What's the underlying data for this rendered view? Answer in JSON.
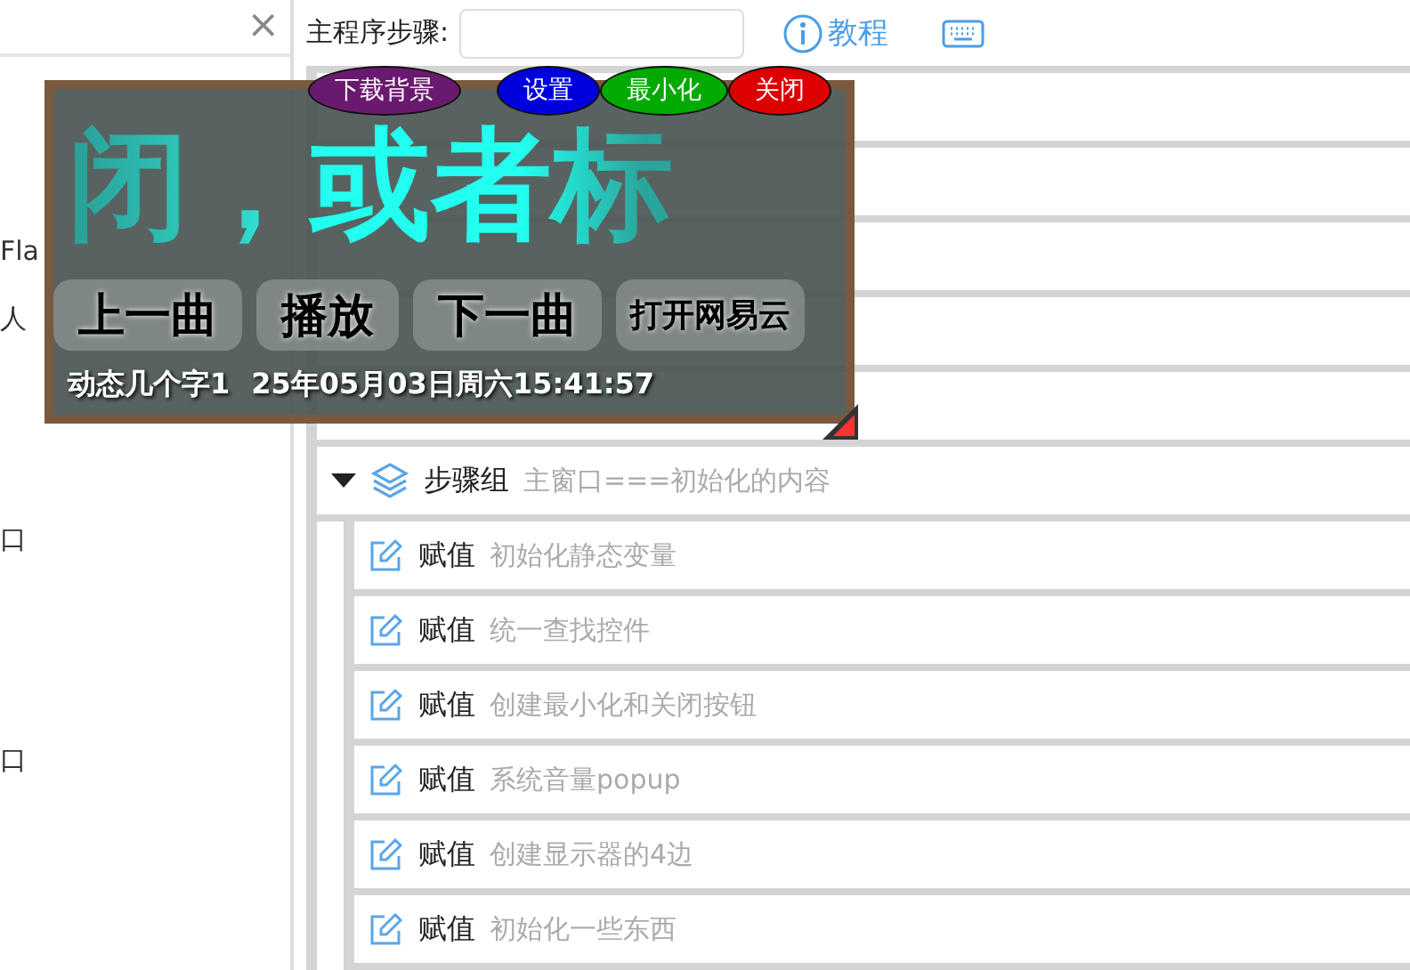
{
  "left_panel": {
    "close": "×",
    "fragments": [
      "Fla",
      "人",
      "口",
      "口"
    ]
  },
  "toolbar": {
    "label": "主程序步骤:",
    "tutorial": "教程"
  },
  "steps": [
    {
      "kind": "blank"
    },
    {
      "kind": "blank"
    },
    {
      "kind": "blank"
    },
    {
      "kind": "blank"
    },
    {
      "kind": "blank"
    },
    {
      "kind": "group",
      "action": "步骤组",
      "note": "主窗口===初始化的内容",
      "expanded": true,
      "children": [
        {
          "kind": "assign",
          "action": "赋值",
          "note": "初始化静态变量"
        },
        {
          "kind": "assign",
          "action": "赋值",
          "note": "统一查找控件"
        },
        {
          "kind": "assign",
          "action": "赋值",
          "note": "创建最小化和关闭按钮"
        },
        {
          "kind": "assign",
          "action": "赋值",
          "note": "系统音量popup"
        },
        {
          "kind": "assign",
          "action": "赋值",
          "note": "创建显示器的4边"
        },
        {
          "kind": "assign",
          "action": "赋值",
          "note": "初始化一些东西"
        }
      ]
    }
  ],
  "player": {
    "top_buttons": [
      {
        "label": "下载背景",
        "color": "#6a1a6e"
      },
      {
        "label": "设置",
        "color": "#0000dd"
      },
      {
        "label": "最小化",
        "color": "#00aa00"
      },
      {
        "label": "关闭",
        "color": "#dd0000"
      }
    ],
    "lyric": "闭，或者标",
    "controls": [
      "上一曲",
      "播放",
      "下一曲",
      "打开网易云"
    ],
    "caption": "动态几个字1",
    "datetime": "25年05月03日周六15:41:57"
  }
}
